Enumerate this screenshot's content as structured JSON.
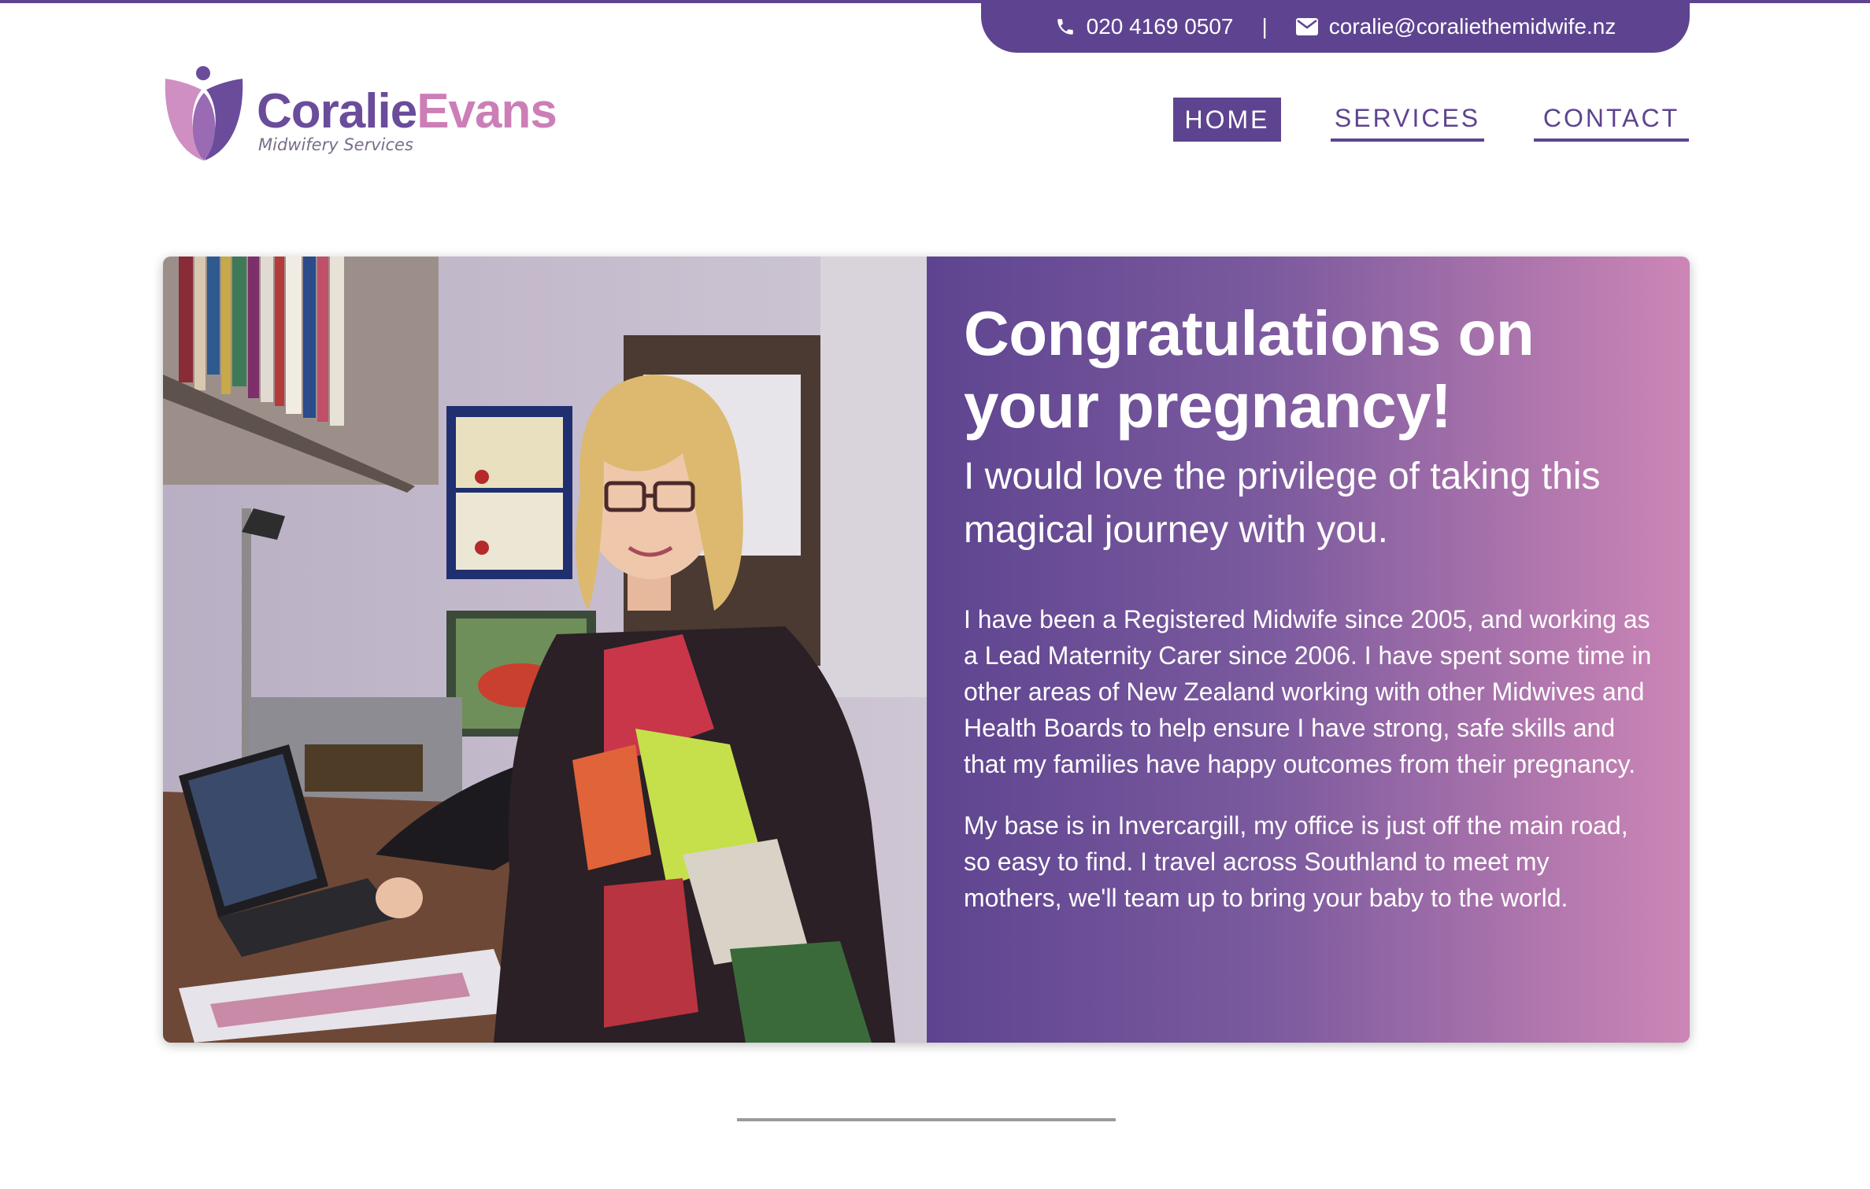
{
  "header": {
    "phone": "020 4169 0507",
    "separator": "|",
    "email": "coralie@coraliethemidwife.nz",
    "phone_icon": "phone-icon",
    "email_icon": "envelope-icon"
  },
  "logo": {
    "first": "Coralie",
    "last": "Evans",
    "tagline": "Midwifery Services"
  },
  "nav": {
    "home": "HOME",
    "services": "SERVICES",
    "contact": "CONTACT"
  },
  "hero": {
    "title": "Congratulations on your pregnancy!",
    "subtitle": "I would love the privilege of taking this magical journey with you.",
    "paragraph1": "I have been a Registered Midwife since 2005, and working as a Lead Maternity Carer since 2006. I have spent some time in other areas of New Zealand working with other Midwives and Health Boards to help ensure I have strong, safe skills and that my families have happy outcomes from their pregnancy.",
    "paragraph2": "My base is in Invercargill, my office is just off the main road, so easy to find. I travel across Southland to meet my mothers, we'll team up to bring your baby to the world."
  },
  "colors": {
    "brand_purple": "#5e4490",
    "brand_pink": "#cd86b6",
    "divider": "#9a9a9a"
  }
}
